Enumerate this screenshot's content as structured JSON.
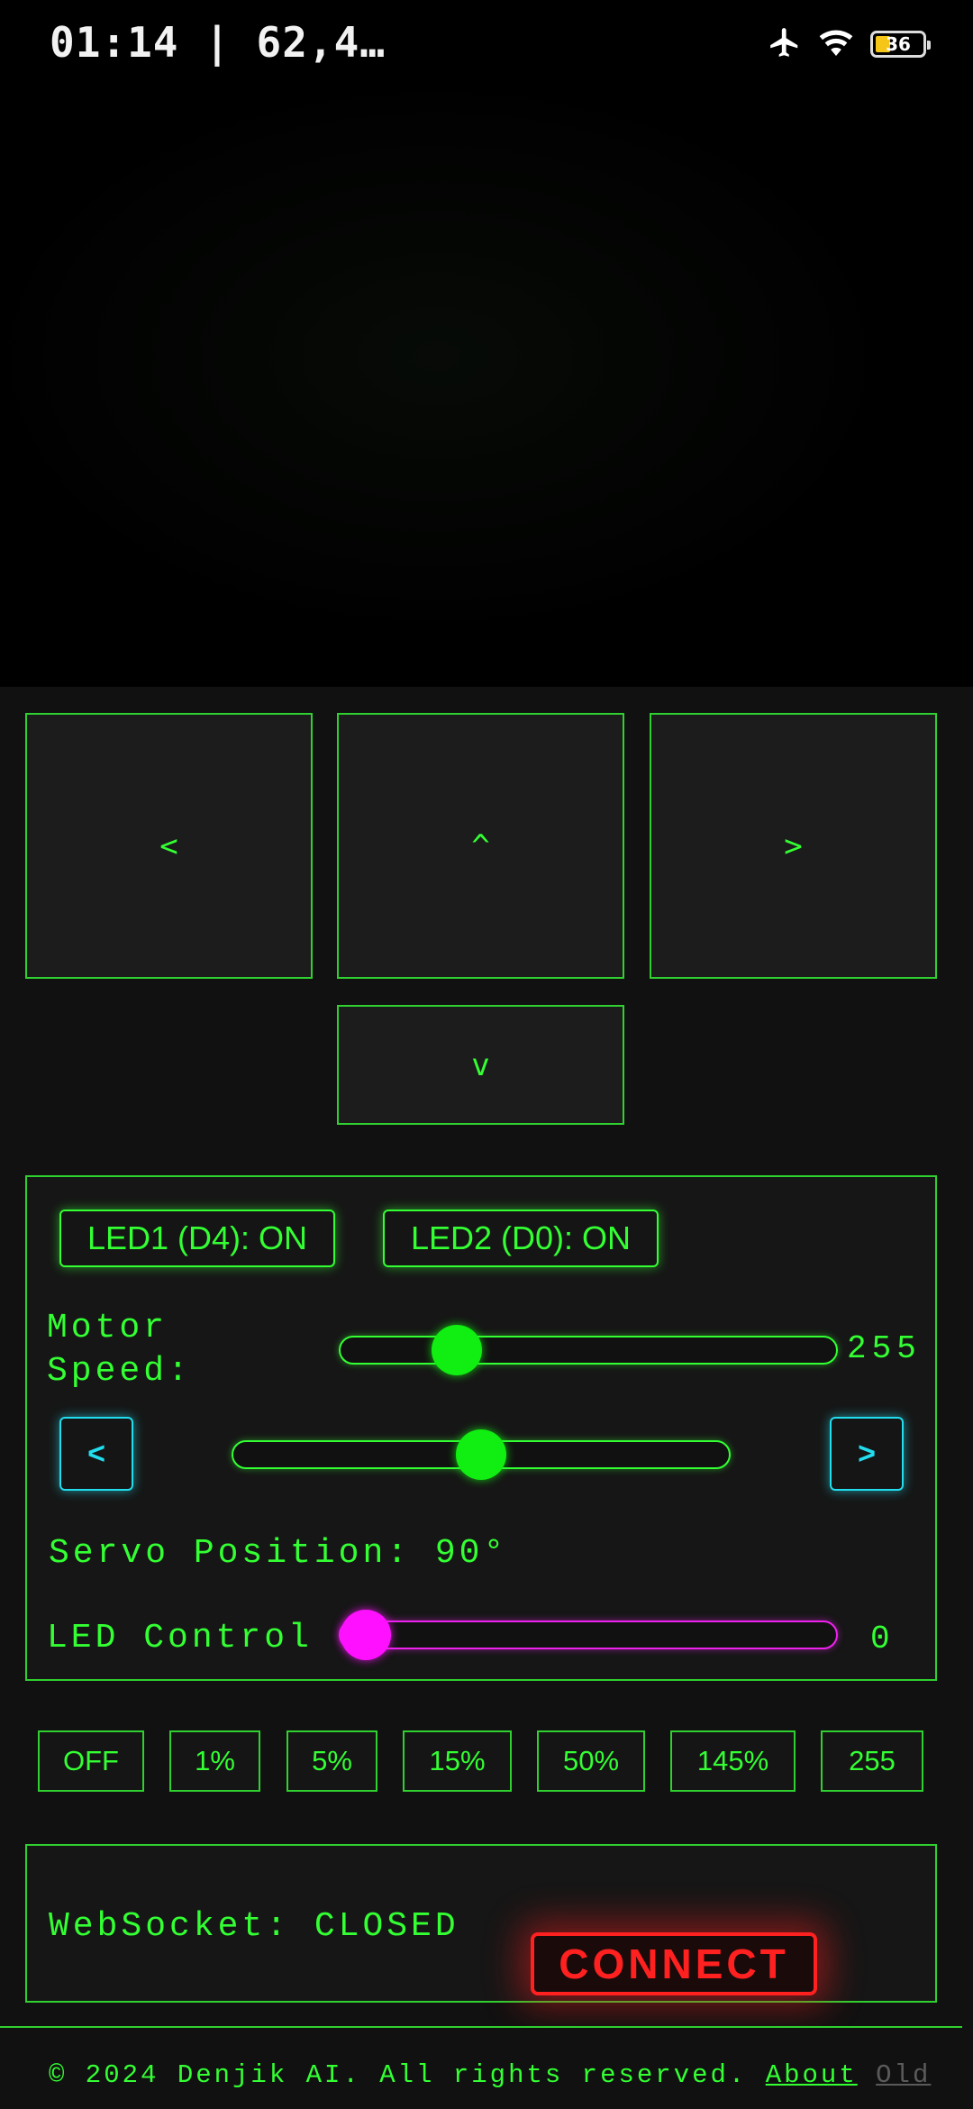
{
  "status_bar": {
    "time": "01:14 | 62,4…",
    "battery": "36"
  },
  "controls": {
    "left": "<",
    "up": "^",
    "right": ">",
    "down": "v"
  },
  "panel": {
    "led1_label": "LED1 (D4): ON",
    "led2_label": "LED2 (D0): ON",
    "motor_label": "Motor\nSpeed:",
    "motor_value": "255",
    "motor_level": 0.205,
    "servo_left": "<",
    "servo_right": ">",
    "servo_level": 0.5,
    "servo_position": "Servo Position: 90°",
    "led_control_label": "LED Control",
    "led_control_value": "0",
    "led_level": 0.0
  },
  "presets": [
    "OFF",
    "1%",
    "5%",
    "15%",
    "50%",
    "145%",
    "255"
  ],
  "websocket": {
    "status": "WebSocket: CLOSED",
    "connect_label": "CONNECT"
  },
  "footer": {
    "copyright": "© 2024 Denjik AI. All rights reserved.",
    "about": "About",
    "old": "Old"
  },
  "colors": {
    "accent_green": "#33ff33",
    "servo_cyan": "#22ddee",
    "led_magenta": "#ff10ff",
    "connect_red": "#ff2020"
  }
}
